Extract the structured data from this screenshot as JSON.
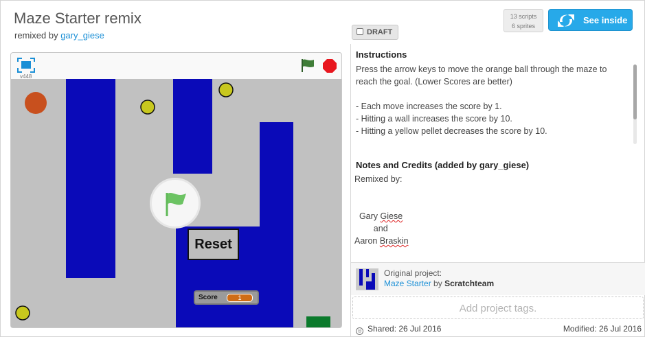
{
  "header": {
    "title": "Maze Starter remix",
    "remixed_prefix": "remixed by",
    "remixed_user": "gary_giese",
    "draft_label": "DRAFT",
    "scripts_count": "13 scripts",
    "sprites_count": "6 sprites",
    "see_inside_label": "See inside"
  },
  "player": {
    "version": "v448",
    "reset_label": "Reset",
    "score_label": "Score",
    "score_value": "1",
    "colors": {
      "wall": "#0a0ab8",
      "floor": "#c1c1c1",
      "ball": "#c8501e",
      "pellet": "#c8c81e",
      "goal": "#0b7a2c"
    }
  },
  "instructions": {
    "title": "Instructions",
    "text": "Press the arrow keys to move the orange ball through the maze to reach the goal. (Lower Scores are better)\n\n- Each move increases the score by 1.\n- Hitting a wall increases the score by 10.\n- Hitting a yellow pellet decreases the score by 10."
  },
  "notes": {
    "title": "Notes and Credits (added by gary_giese)",
    "line1": "Remixed by:",
    "name1_first": "Gary",
    "name1_last": "Giese",
    "and": "and",
    "name2_first": "Aaron",
    "name2_last": "Braskin"
  },
  "original": {
    "label": "Original project:",
    "project": "Maze Starter",
    "by": "by",
    "author": "Scratchteam"
  },
  "tags_placeholder": "Add project tags.",
  "footer": {
    "shared": "Shared: 26 Jul 2016",
    "modified": "Modified: 26 Jul 2016"
  }
}
